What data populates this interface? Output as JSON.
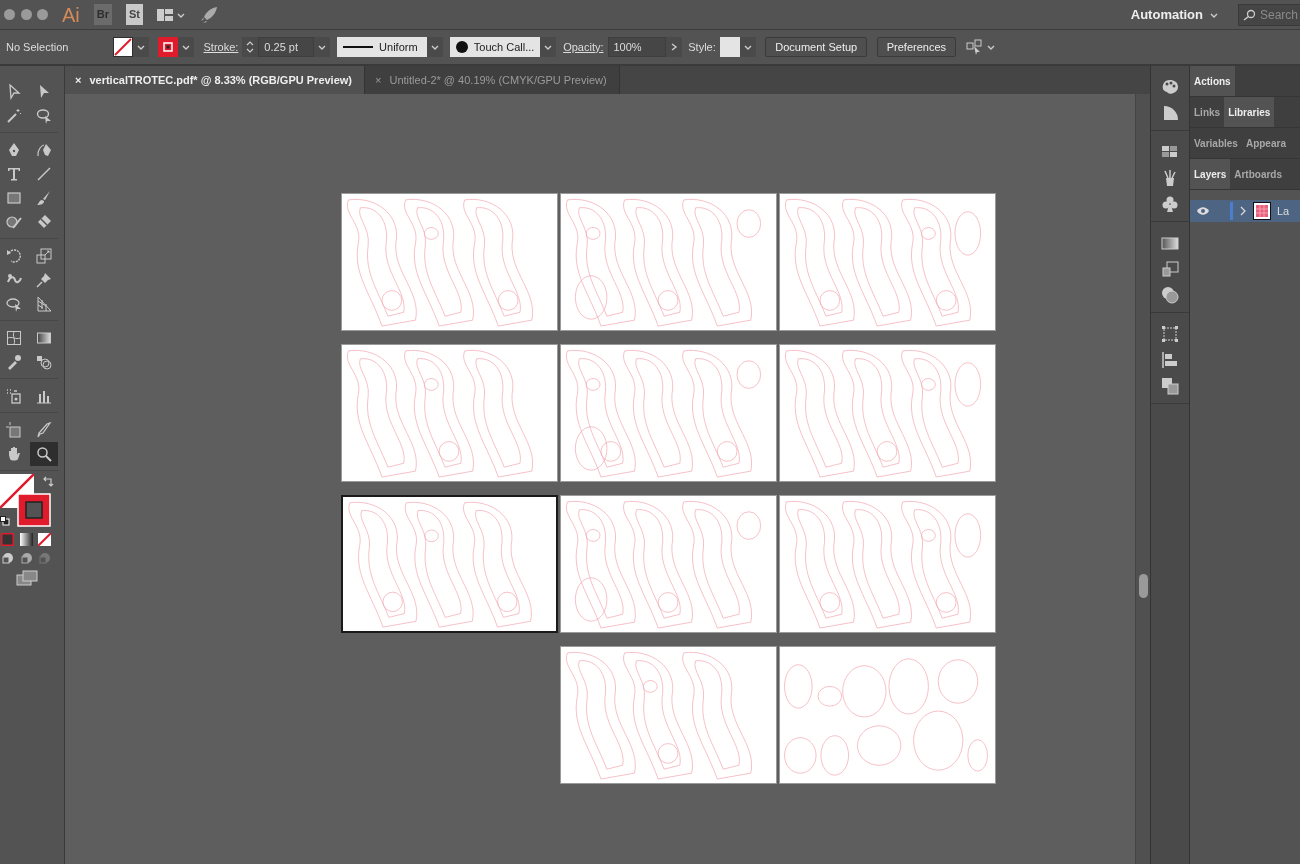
{
  "app": {
    "logo": "Ai",
    "bridge": "Br",
    "stock": "St"
  },
  "workspace": {
    "label": "Automation"
  },
  "search": {
    "placeholder": "Search"
  },
  "control_bar": {
    "selection": "No Selection",
    "stroke_label": "Stroke:",
    "stroke_weight": "0.25 pt",
    "profile": "Uniform",
    "brush": "Touch Call...",
    "opacity_label": "Opacity:",
    "opacity": "100%",
    "style_label": "Style:",
    "buttons": [
      "Document Setup",
      "Preferences"
    ]
  },
  "tabs": [
    {
      "close": "×",
      "title": "verticalTROTEC.pdf* @ 8.33% (RGB/GPU Preview)",
      "selected": true
    },
    {
      "close": "×",
      "title": "Untitled-2* @ 40.19% (CMYK/GPU Preview)",
      "selected": false
    }
  ],
  "tool_groups": [
    {
      "tools": [
        {
          "kind": "selection",
          "selected": false
        },
        {
          "kind": "direct-selection",
          "selected": false
        },
        {
          "kind": "magic-wand",
          "selected": false
        },
        {
          "kind": "lasso",
          "selected": false
        }
      ]
    },
    {
      "tools": [
        {
          "kind": "pen",
          "selected": false
        },
        {
          "kind": "curvature",
          "selected": false
        },
        {
          "kind": "type",
          "selected": false
        },
        {
          "kind": "line",
          "selected": false
        },
        {
          "kind": "rectangle",
          "selected": false
        },
        {
          "kind": "paintbrush",
          "selected": false
        },
        {
          "kind": "shaper",
          "selected": false
        },
        {
          "kind": "eraser",
          "selected": false
        }
      ]
    },
    {
      "tools": [
        {
          "kind": "rotate",
          "selected": false
        },
        {
          "kind": "scale",
          "selected": false
        },
        {
          "kind": "warp",
          "selected": false
        },
        {
          "kind": "pin",
          "selected": false
        },
        {
          "kind": "free-transform",
          "selected": false
        },
        {
          "kind": "perspective",
          "selected": false
        }
      ]
    },
    {
      "tools": [
        {
          "kind": "mesh",
          "selected": false
        },
        {
          "kind": "gradient",
          "selected": false
        },
        {
          "kind": "eyedropper",
          "selected": false
        },
        {
          "kind": "blend",
          "selected": false
        }
      ]
    },
    {
      "tools": [
        {
          "kind": "sprayer",
          "selected": false
        },
        {
          "kind": "graph",
          "selected": false
        }
      ]
    },
    {
      "tools": [
        {
          "kind": "artboard",
          "selected": false
        },
        {
          "kind": "knife",
          "selected": false
        },
        {
          "kind": "hand",
          "selected": false
        },
        {
          "kind": "zoom",
          "selected": true
        }
      ]
    }
  ],
  "artboard_rows": [
    {
      "artboards": [
        {
          "kind": "artboard",
          "selected": false
        },
        {
          "kind": "artboard",
          "selected": false
        },
        {
          "kind": "artboard",
          "selected": false
        }
      ]
    },
    {
      "artboards": [
        {
          "kind": "artboard",
          "selected": false
        },
        {
          "kind": "artboard",
          "selected": false
        },
        {
          "kind": "artboard",
          "selected": false
        }
      ]
    },
    {
      "artboards": [
        {
          "kind": "artboard",
          "selected": true
        },
        {
          "kind": "artboard",
          "selected": false
        },
        {
          "kind": "artboard",
          "selected": false
        }
      ]
    },
    {
      "artboards": [
        {
          "kind": "empty"
        },
        {
          "kind": "artboard",
          "selected": false
        },
        {
          "kind": "artboard",
          "selected": false
        }
      ]
    }
  ],
  "panel_groups": [
    {
      "tabs": [
        {
          "label": "Actions",
          "selected": true
        }
      ]
    },
    {
      "tabs": [
        {
          "label": "Links",
          "selected": false
        },
        {
          "label": "Libraries",
          "selected": true
        }
      ]
    },
    {
      "tabs": [
        {
          "label": "Variables",
          "selected": false
        },
        {
          "label": "Appeara",
          "selected": false
        }
      ]
    },
    {
      "tabs": [
        {
          "label": "Layers",
          "selected": true
        },
        {
          "label": "Artboards",
          "selected": false
        }
      ]
    }
  ],
  "layers": [
    {
      "name": "La",
      "visible": true,
      "expanded": false,
      "selected": true
    }
  ]
}
